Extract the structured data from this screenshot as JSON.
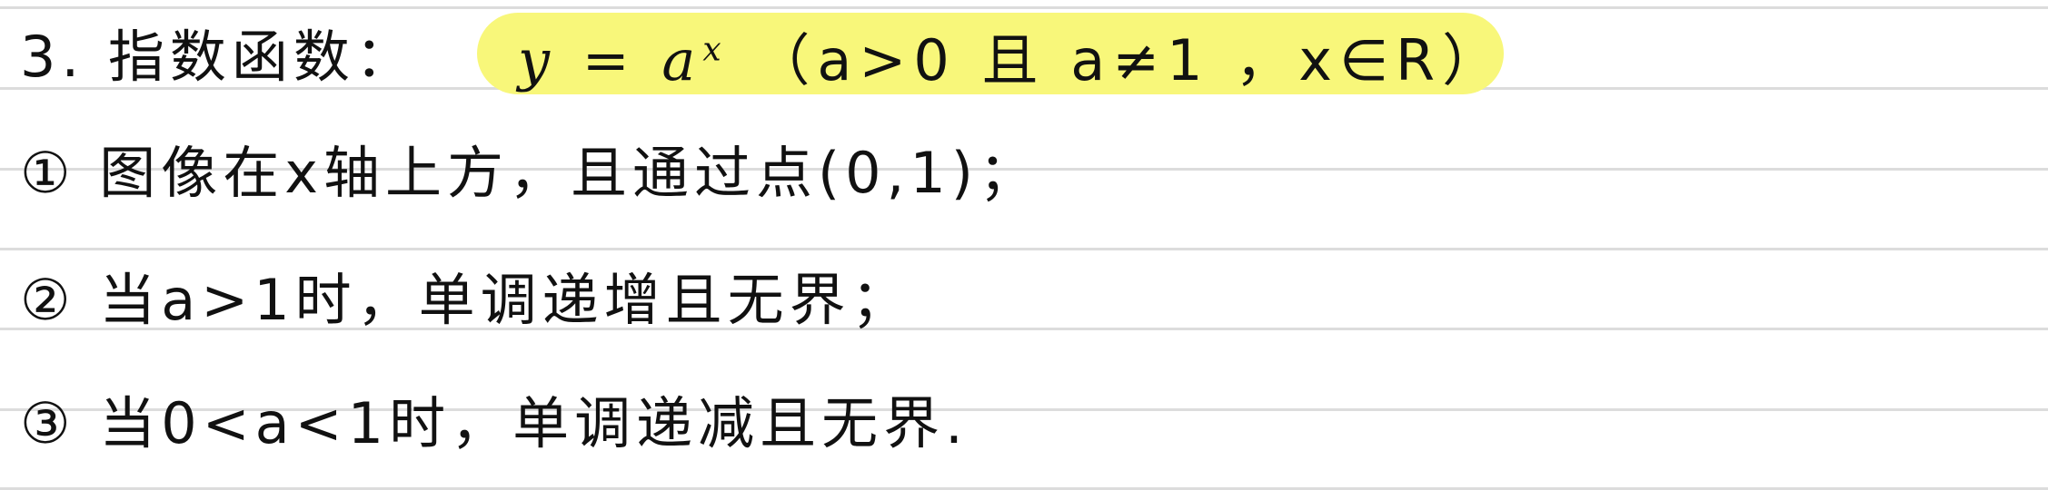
{
  "colors": {
    "highlight": "#f8f77a",
    "ruled_line": "#dcdcdc",
    "ink": "#111111"
  },
  "heading": {
    "label": "3. 指数函数：",
    "formula_base": "y = a",
    "formula_exp": "x",
    "formula_condition": "（a>0 且 a≠1 ，x∈R）"
  },
  "items": [
    "① 图像在x轴上方，且通过点(0,1)；",
    "② 当a>1时，单调递增且无界；",
    "③ 当0<a<1时，单调递减且无界."
  ]
}
